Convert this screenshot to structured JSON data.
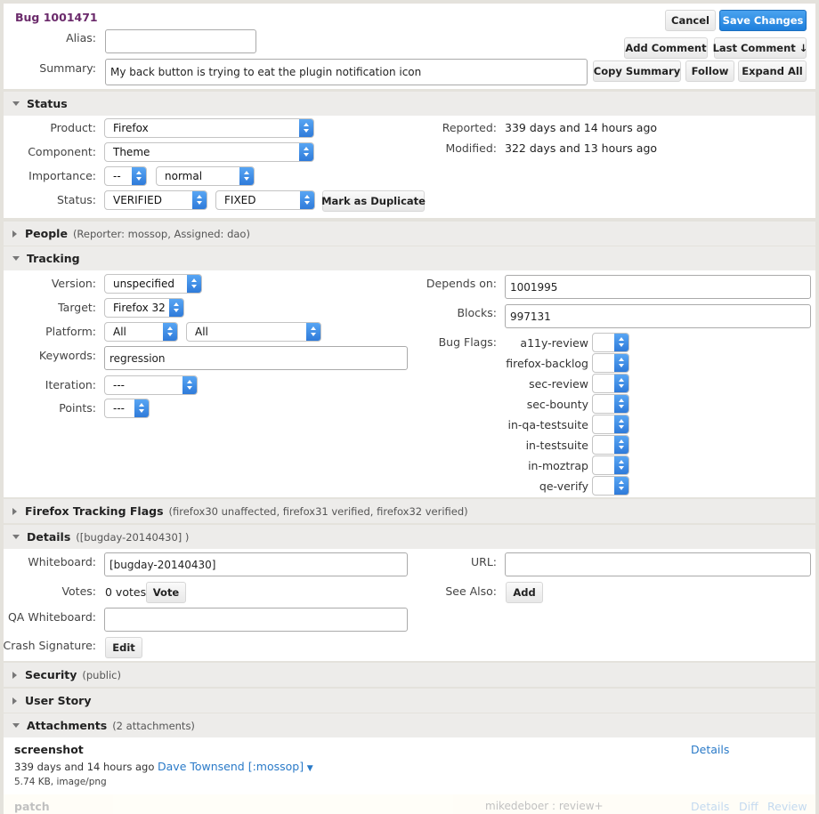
{
  "header": {
    "bug_title": "Bug 1001471",
    "alias_label": "Alias:",
    "alias_value": "",
    "summary_label": "Summary:",
    "summary_value": "My back button is trying to eat the plugin notification icon",
    "cancel": "Cancel",
    "save_changes": "Save Changes",
    "add_comment": "Add Comment",
    "last_comment": "Last Comment ↓",
    "copy_summary": "Copy Summary",
    "follow": "Follow",
    "expand_all": "Expand All"
  },
  "status": {
    "title": "Status",
    "product_label": "Product:",
    "product": "Firefox",
    "component_label": "Component:",
    "component": "Theme",
    "importance_label": "Importance:",
    "priority": "--",
    "severity": "normal",
    "status_label": "Status:",
    "status": "VERIFIED",
    "resolution": "FIXED",
    "mark_duplicate": "Mark as Duplicate",
    "reported_label": "Reported:",
    "reported": "339 days and 14 hours ago",
    "modified_label": "Modified:",
    "modified": "322 days and 13 hours ago"
  },
  "people": {
    "title": "People",
    "note": "(Reporter: mossop, Assigned: dao)"
  },
  "tracking": {
    "title": "Tracking",
    "version_label": "Version:",
    "version": "unspecified",
    "target_label": "Target:",
    "target": "Firefox 32",
    "platform_label": "Platform:",
    "platform_hw": "All",
    "platform_os": "All",
    "keywords_label": "Keywords:",
    "keywords": "regression",
    "iteration_label": "Iteration:",
    "iteration": "---",
    "points_label": "Points:",
    "points": "---",
    "depends_label": "Depends on:",
    "depends": "1001995",
    "blocks_label": "Blocks:",
    "blocks": "997131",
    "bugflags_label": "Bug Flags:",
    "flags": [
      "a11y-review",
      "firefox-backlog",
      "sec-review",
      "sec-bounty",
      "in-qa-testsuite",
      "in-testsuite",
      "in-moztrap",
      "qe-verify"
    ]
  },
  "ff_tracking": {
    "title": "Firefox Tracking Flags",
    "note": "(firefox30 unaffected, firefox31 verified, firefox32 verified)"
  },
  "details": {
    "title": "Details",
    "note": "([bugday-20140430] )",
    "whiteboard_label": "Whiteboard:",
    "whiteboard": "[bugday-20140430]",
    "votes_label": "Votes:",
    "votes": "0 votes",
    "vote_button": "Vote",
    "qa_whiteboard_label": "QA Whiteboard:",
    "qa_whiteboard": "",
    "crash_label": "Crash Signature:",
    "edit_button": "Edit",
    "url_label": "URL:",
    "url": "",
    "see_also_label": "See Also:",
    "add_button": "Add"
  },
  "security": {
    "title": "Security",
    "note": "(public)"
  },
  "user_story": {
    "title": "User Story"
  },
  "attachments": {
    "title": "Attachments",
    "note": "(2 attachments)",
    "items": [
      {
        "name": "screenshot",
        "meta": "339 days and 14 hours ago",
        "author": "Dave Townsend [:mossop]",
        "size": "5.74 KB, image/png",
        "details": "Details"
      },
      {
        "name": "patch",
        "review": "mikedeboer : review+",
        "details": "Details",
        "diff": "Diff",
        "review_link": "Review"
      }
    ]
  }
}
